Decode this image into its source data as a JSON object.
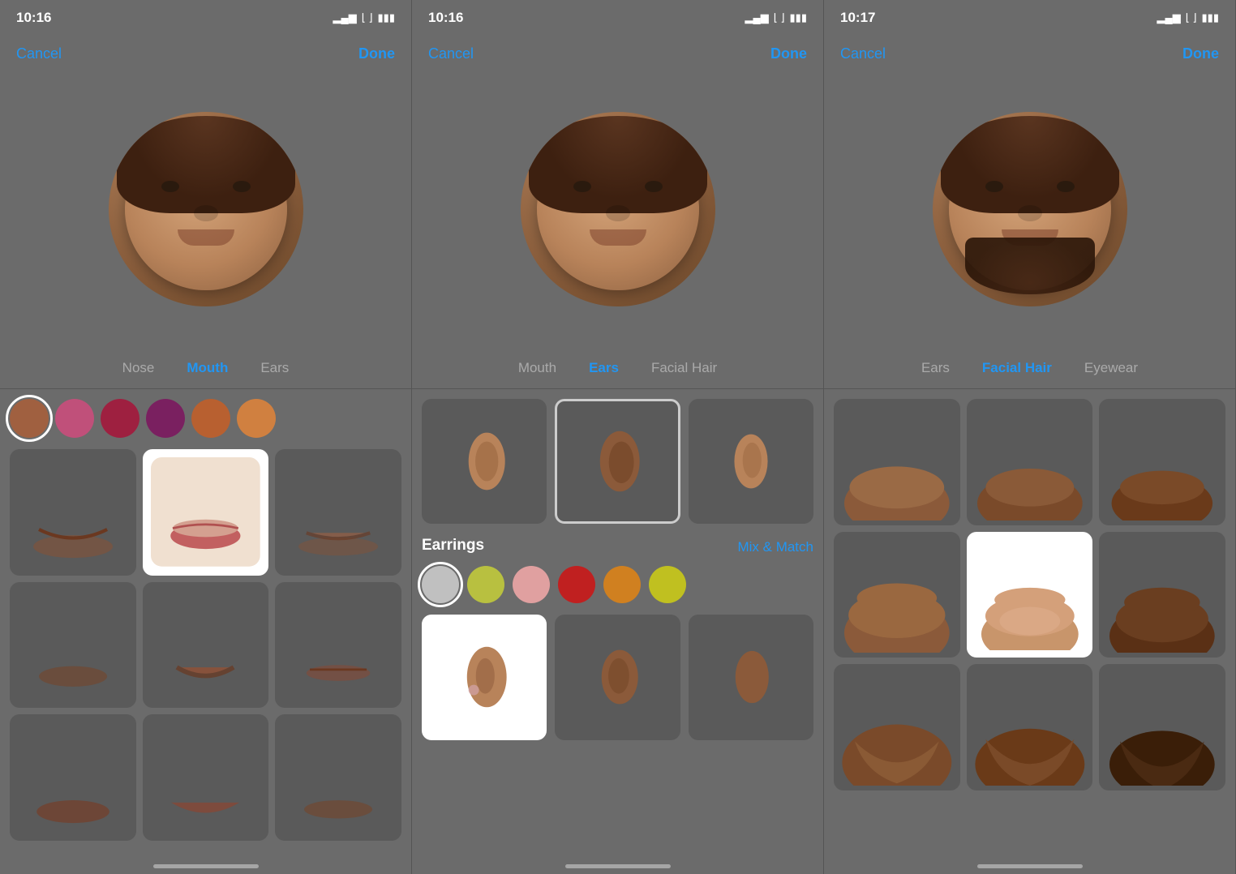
{
  "panels": [
    {
      "id": "panel1",
      "statusBar": {
        "time": "10:16",
        "wifi": "wifi",
        "battery": "battery",
        "signal": "signal"
      },
      "nav": {
        "cancel": "Cancel",
        "done": "Done"
      },
      "categories": [
        {
          "label": "Nose",
          "active": false
        },
        {
          "label": "Mouth",
          "active": true
        },
        {
          "label": "Ears",
          "active": false
        }
      ],
      "colors": [
        {
          "hex": "#a06040",
          "selected": true
        },
        {
          "hex": "#c0507a"
        },
        {
          "hex": "#9e2040"
        },
        {
          "hex": "#7a2060"
        },
        {
          "hex": "#b86030"
        },
        {
          "hex": "#d08040"
        }
      ],
      "selectedOption": 1
    },
    {
      "id": "panel2",
      "statusBar": {
        "time": "10:16"
      },
      "nav": {
        "cancel": "Cancel",
        "done": "Done"
      },
      "categories": [
        {
          "label": "Mouth",
          "active": false
        },
        {
          "label": "Ears",
          "active": true
        },
        {
          "label": "Facial Hair",
          "active": false
        }
      ],
      "earrings": {
        "title": "Earrings",
        "mixMatch": "Mix & Match",
        "colors": [
          {
            "hex": "#c0c0c0",
            "selected": true
          },
          {
            "hex": "#b8c040"
          },
          {
            "hex": "#e0a0a0"
          },
          {
            "hex": "#c02020"
          },
          {
            "hex": "#d08020"
          },
          {
            "hex": "#c0c020"
          }
        ]
      },
      "selectedEarOption": 1
    },
    {
      "id": "panel3",
      "statusBar": {
        "time": "10:17"
      },
      "nav": {
        "cancel": "Cancel",
        "done": "Done"
      },
      "categories": [
        {
          "label": "Ears",
          "active": false
        },
        {
          "label": "Facial Hair",
          "active": true
        },
        {
          "label": "Eyewear",
          "active": false
        }
      ],
      "selectedBeardOption": 4
    }
  ]
}
